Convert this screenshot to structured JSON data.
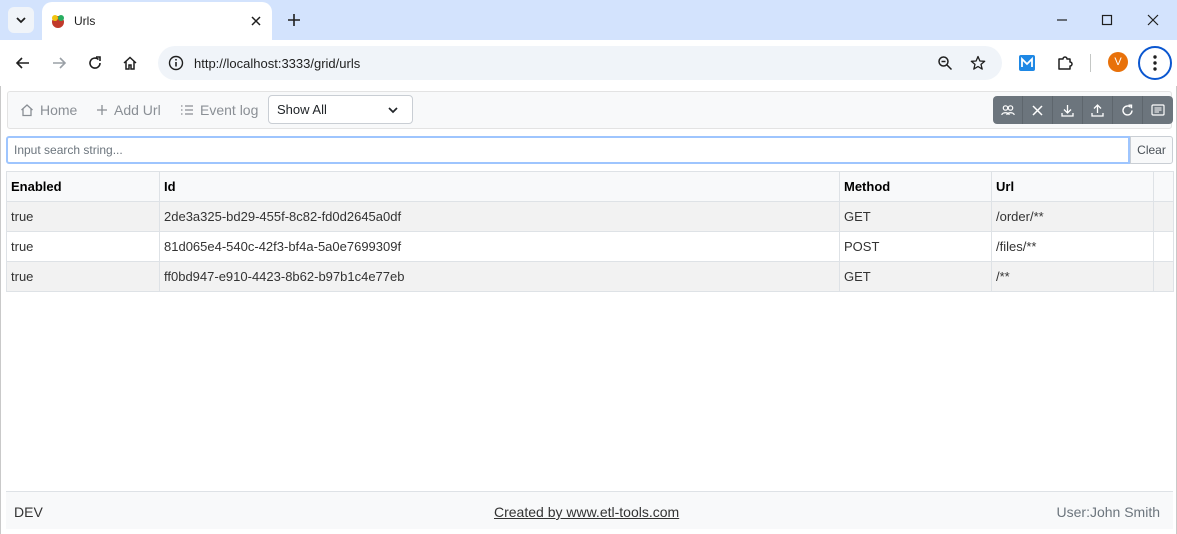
{
  "browser": {
    "tab": {
      "title": "Urls"
    },
    "address": {
      "url": "http://localhost:3333/grid/urls"
    },
    "profile_initial": "V"
  },
  "app": {
    "nav": {
      "home_label": "Home",
      "add_url_label": "Add Url",
      "event_log_label": "Event log"
    },
    "filter": {
      "selected": "Show All"
    },
    "search": {
      "placeholder": "Input search string...",
      "value": "",
      "clear_label": "Clear"
    },
    "grid": {
      "columns": [
        "Enabled",
        "Id",
        "Method",
        "Url",
        ""
      ],
      "rows": [
        {
          "enabled": "true",
          "id": "2de3a325-bd29-455f-8c82-fd0d2645a0df",
          "method": "GET",
          "url": "/order/**"
        },
        {
          "enabled": "true",
          "id": "81d065e4-540c-42f3-bf4a-5a0e7699309f",
          "method": "POST",
          "url": "/files/**"
        },
        {
          "enabled": "true",
          "id": "ff0bd947-e910-4423-8b62-b97b1c4e77eb",
          "method": "GET",
          "url": "/**"
        }
      ]
    },
    "footer": {
      "env": "DEV",
      "credit": "Created by www.etl-tools.com",
      "user": "User:John Smith"
    }
  },
  "colors": {
    "tabstrip": "#d3e3fd",
    "omnibox": "#f0f4f9",
    "accent": "#0b57d0",
    "avatar": "#e8710a",
    "button_group": "#6c757d",
    "search_focus": "#9ec5fe"
  },
  "icons": {
    "tab_search": "chevron-down-icon",
    "tab_close": "close-icon",
    "new_tab": "plus-icon",
    "minimize": "minimize-icon",
    "maximize": "maximize-icon",
    "close_window": "close-icon",
    "back": "arrow-left-icon",
    "forward": "arrow-right-icon",
    "reload": "reload-icon",
    "home": "home-icon",
    "site_info": "info-icon",
    "zoom": "zoom-icon",
    "bookmark": "star-icon",
    "extension": "puzzle-icon",
    "menu": "kebab-menu-icon",
    "group_buttons": [
      "users-icon",
      "close-icon",
      "download-icon",
      "upload-icon",
      "refresh-icon",
      "card-icon"
    ]
  }
}
